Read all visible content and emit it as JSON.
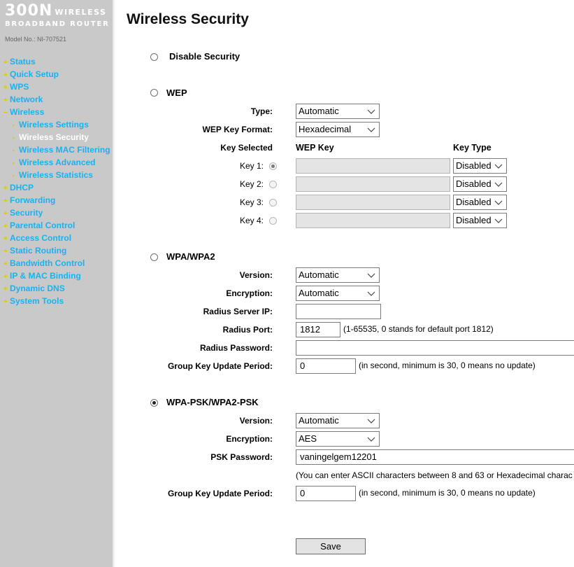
{
  "logo": {
    "line1": "300N",
    "line1_small": "WIRELESS",
    "line2": "BROADBAND ROUTER",
    "model": "Model No.: NI-707521"
  },
  "colors": {
    "sidebar_bg": "#c9c9c9",
    "nav_link": "#1ab2ee",
    "nav_bullet": "#e5c400",
    "nav_current": "#ffffff"
  },
  "nav": [
    {
      "bullet": "+",
      "label": "Status"
    },
    {
      "bullet": "+",
      "label": "Quick Setup"
    },
    {
      "bullet": "+",
      "label": "WPS"
    },
    {
      "bullet": "+",
      "label": "Network"
    },
    {
      "bullet": "−",
      "label": "Wireless"
    },
    {
      "bullet": "•",
      "label": "Wireless Settings"
    },
    {
      "bullet": "•",
      "label": "Wireless Security"
    },
    {
      "bullet": "•",
      "label": "Wireless MAC Filtering"
    },
    {
      "bullet": "•",
      "label": "Wireless Advanced"
    },
    {
      "bullet": "•",
      "label": "Wireless Statistics"
    },
    {
      "bullet": "+",
      "label": "DHCP"
    },
    {
      "bullet": "+",
      "label": "Forwarding"
    },
    {
      "bullet": "+",
      "label": "Security"
    },
    {
      "bullet": "+",
      "label": "Parental Control"
    },
    {
      "bullet": "+",
      "label": "Access Control"
    },
    {
      "bullet": "+",
      "label": "Static Routing"
    },
    {
      "bullet": "+",
      "label": "Bandwidth Control"
    },
    {
      "bullet": "+",
      "label": "IP & MAC Binding"
    },
    {
      "bullet": "+",
      "label": "Dynamic DNS"
    },
    {
      "bullet": "+",
      "label": "System Tools"
    }
  ],
  "page_title": "Wireless Security",
  "disable": {
    "label": "Disable Security",
    "selected": false
  },
  "wep": {
    "label": "WEP",
    "selected": false,
    "type_label": "Type:",
    "type_value": "Automatic",
    "format_label": "WEP Key Format:",
    "format_value": "Hexadecimal",
    "key_selected_header": "Key Selected",
    "wep_key_header": "WEP Key",
    "key_type_header": "Key Type",
    "keys": [
      {
        "label": "Key 1:",
        "value": "",
        "type": "Disabled",
        "selected": true
      },
      {
        "label": "Key 2:",
        "value": "",
        "type": "Disabled",
        "selected": false
      },
      {
        "label": "Key 3:",
        "value": "",
        "type": "Disabled",
        "selected": false
      },
      {
        "label": "Key 4:",
        "value": "",
        "type": "Disabled",
        "selected": false
      }
    ]
  },
  "wpa": {
    "label": "WPA/WPA2",
    "selected": false,
    "version_label": "Version:",
    "version_value": "Automatic",
    "encryption_label": "Encryption:",
    "encryption_value": "Automatic",
    "radius_ip_label": "Radius Server IP:",
    "radius_ip_value": "",
    "radius_port_label": "Radius Port:",
    "radius_port_value": "1812",
    "radius_port_hint": "(1-65535, 0 stands for default port 1812)",
    "radius_password_label": "Radius Password:",
    "radius_password_value": "",
    "group_key_label": "Group Key Update Period:",
    "group_key_value": "0",
    "group_key_hint": "(in second, minimum is 30, 0 means no update)"
  },
  "psk": {
    "label": "WPA-PSK/WPA2-PSK",
    "selected": true,
    "version_label": "Version:",
    "version_value": "Automatic",
    "encryption_label": "Encryption:",
    "encryption_value": "AES",
    "password_label": "PSK Password:",
    "password_value": "vaningelgem12201",
    "password_hint": "(You can enter ASCII characters between 8 and 63 or Hexadecimal charac",
    "group_key_label": "Group Key Update Period:",
    "group_key_value": "0",
    "group_key_hint": "(in second, minimum is 30, 0 means no update)"
  },
  "save_label": "Save"
}
